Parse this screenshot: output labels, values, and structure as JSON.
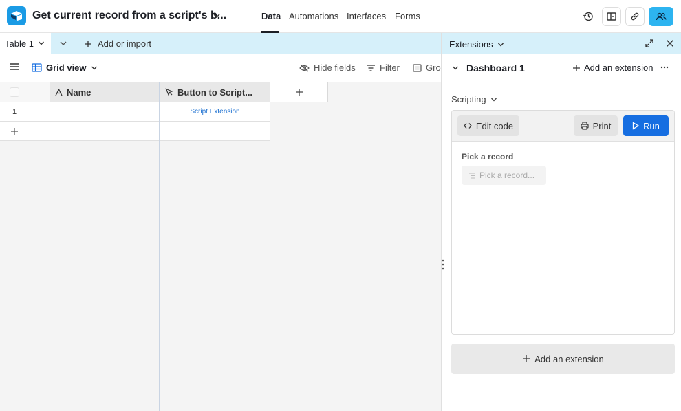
{
  "header": {
    "base_title": "Get current record from a script's b...",
    "tabs": [
      {
        "label": "Data",
        "active": true
      },
      {
        "label": "Automations",
        "active": false
      },
      {
        "label": "Interfaces",
        "active": false
      },
      {
        "label": "Forms",
        "active": false
      }
    ],
    "icons": [
      "history-icon",
      "layout-icon",
      "link-icon",
      "share-icon"
    ]
  },
  "tabbar": {
    "table_tab": "Table 1",
    "add_import": "Add or import"
  },
  "viewbar": {
    "view_name": "Grid view",
    "hide_fields": "Hide fields",
    "filter": "Filter",
    "group": "Grou"
  },
  "grid": {
    "columns": [
      {
        "label": "Name",
        "icon": "text-field-icon"
      },
      {
        "label": "Button to Script...",
        "icon": "cursor-icon"
      }
    ],
    "rows": [
      {
        "number": "1",
        "name": "",
        "button": "Script Extension"
      }
    ]
  },
  "extensions": {
    "title": "Extensions",
    "dashboard_title": "Dashboard 1",
    "add_extension": "Add an extension",
    "scripting_label": "Scripting",
    "edit_code": "Edit code",
    "print": "Print",
    "run": "Run",
    "pick_record_label": "Pick a record",
    "pick_record_placeholder": "Pick a record...",
    "add_extension_bottom": "Add an extension"
  },
  "colors": {
    "accent_blue": "#166ee1",
    "logo_blue": "#1a9be5",
    "tab_bar_bg": "#d6f0fa",
    "link_blue": "#1a6fd0"
  }
}
